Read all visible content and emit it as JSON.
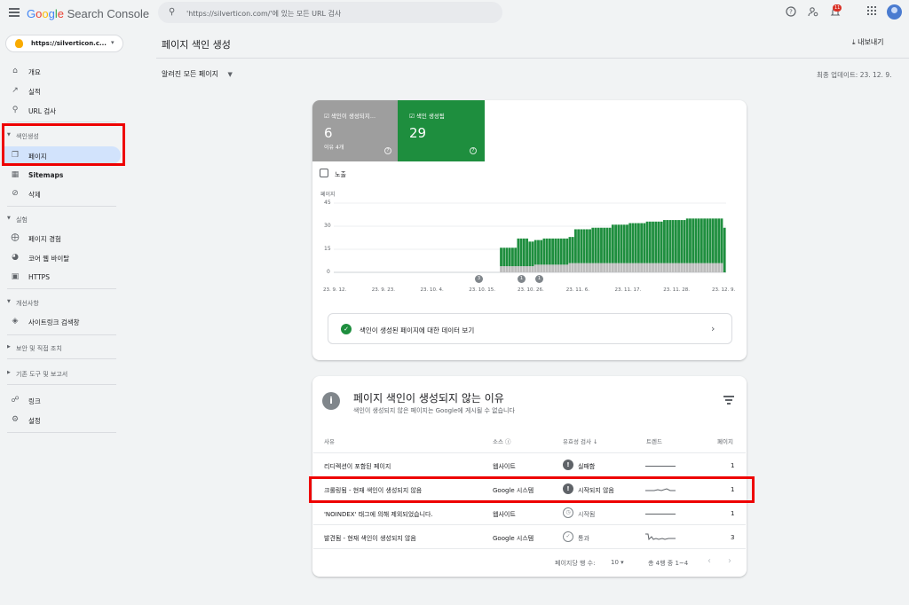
{
  "header": {
    "logo_google": [
      "G",
      "o",
      "o",
      "g",
      "l",
      "e"
    ],
    "logo_product": "Search Console",
    "search_placeholder": "'https://silverticon.com/'에 있는 모든 URL 검사",
    "notifications_count": "11"
  },
  "property": {
    "label": "https://silverticon.c..."
  },
  "sidebar": {
    "items_top": [
      {
        "label": "개요",
        "icon": "home-icon"
      },
      {
        "label": "실적",
        "icon": "trending-icon"
      },
      {
        "label": "URL 검사",
        "icon": "search-icon"
      }
    ],
    "section_indexing": "색인생성",
    "items_indexing": [
      {
        "label": "페이지",
        "icon": "pages-icon",
        "active": true
      },
      {
        "label": "Sitemaps",
        "icon": "sitemap-icon"
      },
      {
        "label": "삭제",
        "icon": "removal-icon"
      }
    ],
    "section_experience": "실험",
    "items_experience": [
      {
        "label": "페이지 경험",
        "icon": "page-experience-icon"
      },
      {
        "label": "코어 웹 바이탈",
        "icon": "gauge-icon"
      },
      {
        "label": "HTTPS",
        "icon": "lock-icon"
      }
    ],
    "section_enhancements": "개선사항",
    "items_enhancements": [
      {
        "label": "사이트링크 검색창",
        "icon": "layers-icon"
      }
    ],
    "section_security": "보안 및 직접 조치",
    "section_legacy": "기존 도구 및 보고서",
    "items_bottom": [
      {
        "label": "링크",
        "icon": "link-icon"
      },
      {
        "label": "설정",
        "icon": "settings-icon"
      }
    ]
  },
  "main": {
    "title": "페이지 색인 생성",
    "export_label": "내보내기",
    "filter_label": "알려진 모든 페이지",
    "updated": "최종 업데이트: 23. 12. 9.",
    "tile_not_indexed": {
      "label": "색인이 생성되지...",
      "value": "6",
      "sub": "이유 4개",
      "color": "#9e9e9e"
    },
    "tile_indexed": {
      "label": "색인 생성됨",
      "value": "29",
      "color": "#1e8e3e"
    },
    "impressions_label": "노출",
    "view_data_label": "색인이 생성된 페이지에 대한 데이터 보기"
  },
  "chart_data": {
    "type": "bar",
    "stacked": true,
    "ylabel": "페이지",
    "ylim": [
      0,
      45
    ],
    "yticks": [
      "45",
      "30",
      "15",
      "0"
    ],
    "x_tick_labels": [
      "23. 9. 12.",
      "23. 9. 23.",
      "23. 10. 4.",
      "23. 10. 15.",
      "23. 10. 26.",
      "23. 11. 6.",
      "23. 11. 17.",
      "23. 11. 28.",
      "23. 12. 9."
    ],
    "annotations": [
      "3",
      "1",
      "1"
    ],
    "series": [
      {
        "name": "색인 생성됨",
        "color": "#1e8e3e",
        "values": [
          0,
          0,
          0,
          0,
          0,
          0,
          0,
          0,
          0,
          0,
          0,
          0,
          0,
          0,
          0,
          0,
          0,
          0,
          0,
          0,
          0,
          0,
          0,
          0,
          0,
          0,
          0,
          0,
          0,
          0,
          0,
          0,
          0,
          0,
          0,
          0,
          0,
          0,
          0,
          0,
          0,
          0,
          0,
          0,
          0,
          0,
          0,
          0,
          0,
          0,
          0,
          0,
          0,
          0,
          0,
          0,
          0,
          0,
          12,
          12,
          12,
          12,
          12,
          12,
          18,
          18,
          18,
          18,
          16,
          16,
          16,
          16,
          16,
          17,
          17,
          17,
          17,
          17,
          17,
          17,
          17,
          17,
          17,
          17,
          22,
          22,
          22,
          22,
          22,
          22,
          23,
          23,
          23,
          23,
          23,
          23,
          23,
          25,
          25,
          25,
          25,
          25,
          25,
          26,
          26,
          26,
          26,
          26,
          26,
          27,
          27,
          27,
          27,
          27,
          27,
          28,
          28,
          28,
          28,
          28,
          28,
          28,
          28,
          29,
          29,
          29,
          29,
          29,
          29,
          29,
          29,
          29,
          29,
          29,
          29,
          29,
          29
        ]
      },
      {
        "name": "색인이 생성되지 않음",
        "color": "#bdbdbd",
        "values": [
          0,
          0,
          0,
          0,
          0,
          0,
          0,
          0,
          0,
          0,
          0,
          0,
          0,
          0,
          0,
          0,
          0,
          0,
          0,
          0,
          0,
          0,
          0,
          0,
          0,
          0,
          0,
          0,
          0,
          0,
          0,
          0,
          0,
          0,
          0,
          0,
          0,
          0,
          0,
          0,
          0,
          0,
          0,
          0,
          0,
          0,
          0,
          0,
          0,
          0,
          0,
          0,
          0,
          0,
          0,
          0,
          0,
          0,
          4,
          4,
          4,
          4,
          4,
          4,
          4,
          4,
          4,
          4,
          4,
          4,
          5,
          5,
          5,
          5,
          5,
          5,
          5,
          5,
          5,
          5,
          5,
          5,
          6,
          6,
          6,
          6,
          6,
          6,
          6,
          6,
          6,
          6,
          6,
          6,
          6,
          6,
          6,
          6,
          6,
          6,
          6,
          6,
          6,
          6,
          6,
          6,
          6,
          6,
          6,
          6,
          6,
          6,
          6,
          6,
          6,
          6,
          6,
          6,
          6,
          6,
          6,
          6,
          6,
          6,
          6,
          6,
          6,
          6,
          6,
          6,
          6,
          6,
          6,
          6,
          6,
          6
        ]
      }
    ]
  },
  "reasons": {
    "title": "페이지 색인이 생성되지 않는 이유",
    "subtitle": "색인이 생성되지 않은 페이지는 Google에 게시될 수 없습니다",
    "columns": {
      "reason": "사유",
      "source": "소스",
      "validation": "유효성 검사",
      "trend": "트렌드",
      "pages": "페이지"
    },
    "rows": [
      {
        "reason": "리디렉션이 포함된 페이지",
        "source": "웹사이트",
        "validation": "실패함",
        "status": "fail",
        "pages": "1"
      },
      {
        "reason": "크롤링됨 - 현재 색인이 생성되지 않음",
        "source": "Google 시스템",
        "validation": "시작되지 않음",
        "status": "fail",
        "pages": "1"
      },
      {
        "reason": "'NOINDEX' 태그에 의해 제외되었습니다.",
        "source": "웹사이트",
        "validation": "시작됨",
        "status": "started",
        "pages": "1"
      },
      {
        "reason": "발견됨 - 현재 색인이 생성되지 않음",
        "source": "Google 시스템",
        "validation": "통과",
        "status": "passed",
        "pages": "3"
      }
    ],
    "pager": {
      "rows_per_page_label": "페이지당 행 수:",
      "rows_per_page": "10",
      "range": "총 4행 중 1~4"
    }
  }
}
